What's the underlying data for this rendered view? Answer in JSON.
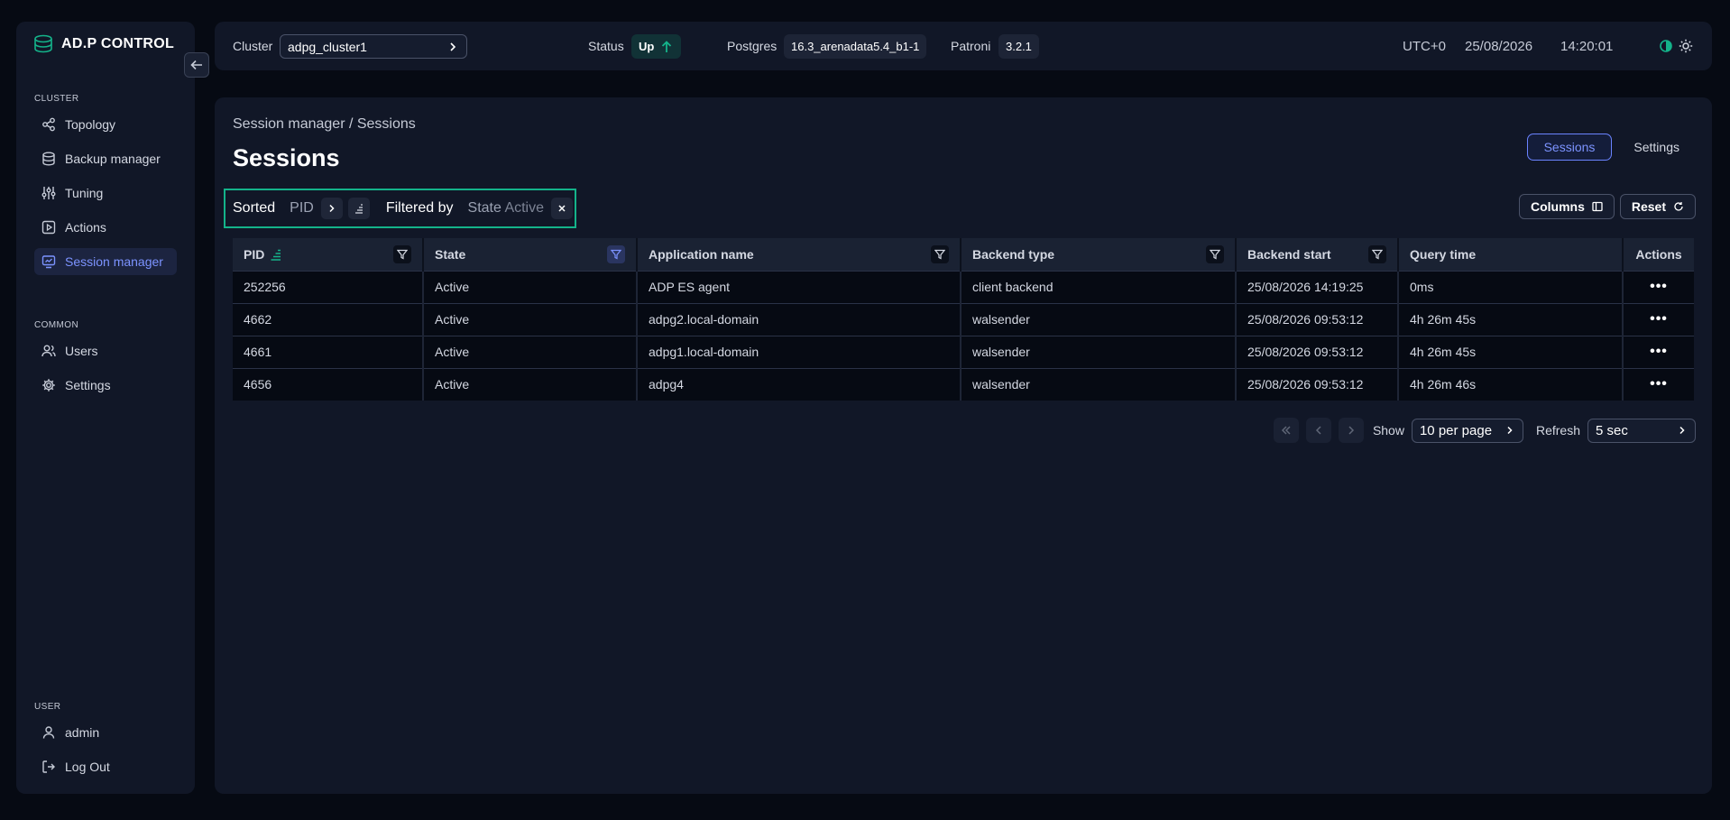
{
  "app": {
    "logo_prefix": "AD.P",
    "logo_suffix": "CONTROL"
  },
  "sidebar": {
    "cluster_section": "CLUSTER",
    "cluster_items": [
      {
        "label": "Topology",
        "icon": "topology-icon"
      },
      {
        "label": "Backup manager",
        "icon": "database-icon"
      },
      {
        "label": "Tuning",
        "icon": "sliders-icon"
      },
      {
        "label": "Actions",
        "icon": "play-icon"
      },
      {
        "label": "Session manager",
        "icon": "monitor-icon",
        "active": true
      }
    ],
    "common_section": "COMMON",
    "common_items": [
      {
        "label": "Users",
        "icon": "users-icon"
      },
      {
        "label": "Settings",
        "icon": "gear-icon"
      }
    ],
    "user_section": "USER",
    "user_items": [
      {
        "label": "admin",
        "icon": "user-icon"
      },
      {
        "label": "Log Out",
        "icon": "logout-icon"
      }
    ]
  },
  "topbar": {
    "cluster_label": "Cluster",
    "cluster_value": "adpg_cluster1",
    "status_label": "Status",
    "status_value": "Up",
    "postgres_label": "Postgres",
    "postgres_value": "16.3_arenadata5.4_b1-1",
    "patroni_label": "Patroni",
    "patroni_value": "3.2.1",
    "timezone": "UTC+0",
    "date": "25/08/2026",
    "time": "14:20:01"
  },
  "main": {
    "breadcrumb": "Session manager / Sessions",
    "title": "Sessions",
    "tabs": [
      {
        "label": "Sessions",
        "active": true
      },
      {
        "label": "Settings",
        "active": false
      }
    ],
    "filter_bar": {
      "sorted_label": "Sorted",
      "sorted_field": "PID",
      "filtered_label": "Filtered by",
      "filter_field": "State",
      "filter_value": "Active"
    },
    "columns_button": "Columns",
    "reset_button": "Reset",
    "table": {
      "headers": [
        "PID",
        "State",
        "Application name",
        "Backend type",
        "Backend start",
        "Query time",
        "Actions"
      ],
      "rows": [
        [
          "252256",
          "Active",
          "ADP ES agent",
          "client backend",
          "25/08/2026 14:19:25",
          "0ms"
        ],
        [
          "4662",
          "Active",
          "adpg2.local-domain",
          "walsender",
          "25/08/2026 09:53:12",
          "4h 26m 45s"
        ],
        [
          "4661",
          "Active",
          "adpg1.local-domain",
          "walsender",
          "25/08/2026 09:53:12",
          "4h 26m 45s"
        ],
        [
          "4656",
          "Active",
          "adpg4",
          "walsender",
          "25/08/2026 09:53:12",
          "4h 26m 46s"
        ]
      ],
      "actions_glyph": "•••"
    },
    "pager": {
      "show_label": "Show",
      "per_page": "10 per page",
      "refresh_label": "Refresh",
      "refresh_value": "5 sec"
    }
  },
  "colors": {
    "accent": "#7c93ff",
    "status_green": "#14b38a",
    "background": "#060a13",
    "panel": "#111727"
  }
}
